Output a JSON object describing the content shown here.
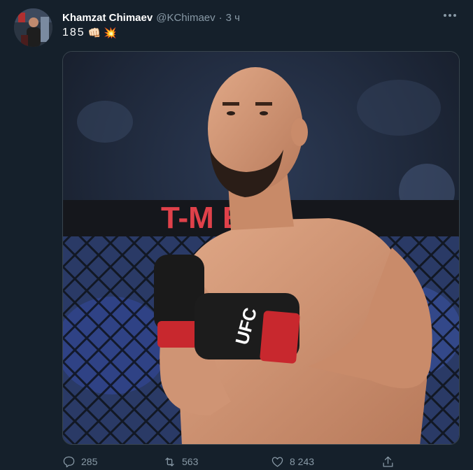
{
  "tweet": {
    "author_name": "Khamzat Chimaev",
    "author_handle": "@KChimaev",
    "separator": "·",
    "time": "3 ч",
    "text": "185",
    "emojis": [
      "👊🏻",
      "💥"
    ],
    "more_icon": "more-horizontal-icon",
    "media": {
      "banner_text": "T-M     E A",
      "glove_logo": "UFC"
    },
    "actions": {
      "reply_count": "285",
      "retweet_count": "563",
      "like_count": "8 243"
    }
  },
  "colors": {
    "background": "#15202b",
    "secondary_text": "#8899a6",
    "border": "#38444d",
    "banner_red": "#e0414a"
  }
}
